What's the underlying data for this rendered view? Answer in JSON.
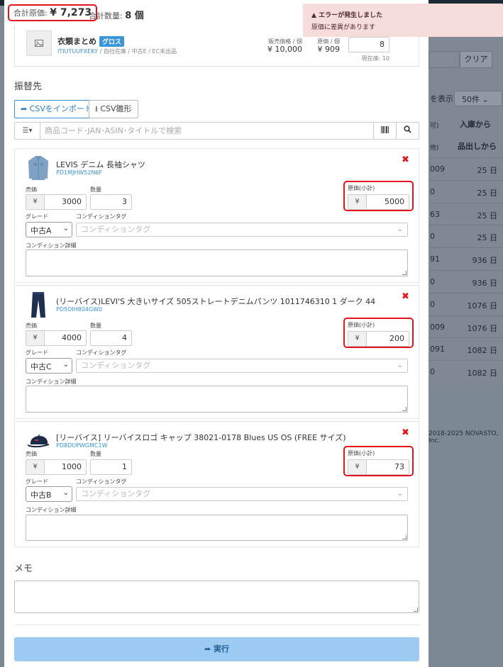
{
  "summary": {
    "total_cost_label": "合計原価:",
    "total_cost_value": "¥ 7,273",
    "total_qty_label": "合計数量:",
    "total_qty_value": "8 個"
  },
  "source_item": {
    "name": "衣類まとめ",
    "badge": "グロス",
    "code": "ITIUTUUFXEKY",
    "meta": " / 自社在庫 / 中古E / EC未出品",
    "sell_price_label": "販売価格 / 個",
    "sell_price": "¥ 10,000",
    "cost_label": "原価 / 個",
    "cost": "¥ 909",
    "qty": "8",
    "stock": "現在庫: 10"
  },
  "transfer": {
    "title": "振替先",
    "import_button": "CSVをインポート",
    "template_button": "CSV雛形",
    "search_placeholder": "商品コード･JAN･ASIN･タイトルで検索"
  },
  "labels": {
    "price": "売価",
    "qty": "数量",
    "cost_subtotal": "原価(小計)",
    "grade": "グレード",
    "condition_tag": "コンディションタグ",
    "condition_detail": "コンディション詳細",
    "yen": "¥",
    "condition_placeholder": "コンディションタグ"
  },
  "items": [
    {
      "name": "LEVIS デニム 長袖シャツ",
      "code": "PD1MJHW52N6F",
      "price": "3000",
      "qty": "3",
      "cost": "5000",
      "grade": "中古A"
    },
    {
      "name": "(リーバイス)LEVI'S 大きいサイズ 505ストレートデニムパンツ 1011746310 1 ダーク 44",
      "code": "PD5OIH804GW0",
      "price": "4000",
      "qty": "4",
      "cost": "200",
      "grade": "中古C"
    },
    {
      "name": "[リーバイス] リーバイスロゴ キャップ 38021-0178 Blues US OS (FREE サイズ)",
      "code": "PD8DUPWGMC1W",
      "price": "1000",
      "qty": "1",
      "cost": "73",
      "grade": "中古B"
    }
  ],
  "memo": {
    "title": "メモ"
  },
  "execute": {
    "label": "実行"
  },
  "toast": {
    "title": "エラーが発生しました",
    "message": "原価に差異があります"
  },
  "background": {
    "clear_button": "クリア",
    "display_label": "を表示",
    "per_page": "50件",
    "col_a": "入庫から",
    "col_a_sub": "可)",
    "col_b": "品出しから",
    "col_b_sub": "他)",
    "rows": [
      {
        "a": "009",
        "b": "25 日"
      },
      {
        "a": "0",
        "b": "25 日"
      },
      {
        "a": "63",
        "b": "25 日"
      },
      {
        "a": "0",
        "b": "25 日"
      },
      {
        "a": "91",
        "b": "936 日"
      },
      {
        "a": "0",
        "b": "936 日"
      },
      {
        "a": "0",
        "b": "1076 日"
      },
      {
        "a": "009",
        "b": "1076 日"
      },
      {
        "a": "091",
        "b": "1082 日"
      },
      {
        "a": "0",
        "b": "1082 日"
      }
    ],
    "copyright": "2018-2025 NOVASTO, Inc."
  },
  "colors": {
    "accent": "#3a95d9",
    "error_red": "#e2131c",
    "execute_button": "#9ccaf0",
    "toast_bg": "#f7dcdc"
  }
}
